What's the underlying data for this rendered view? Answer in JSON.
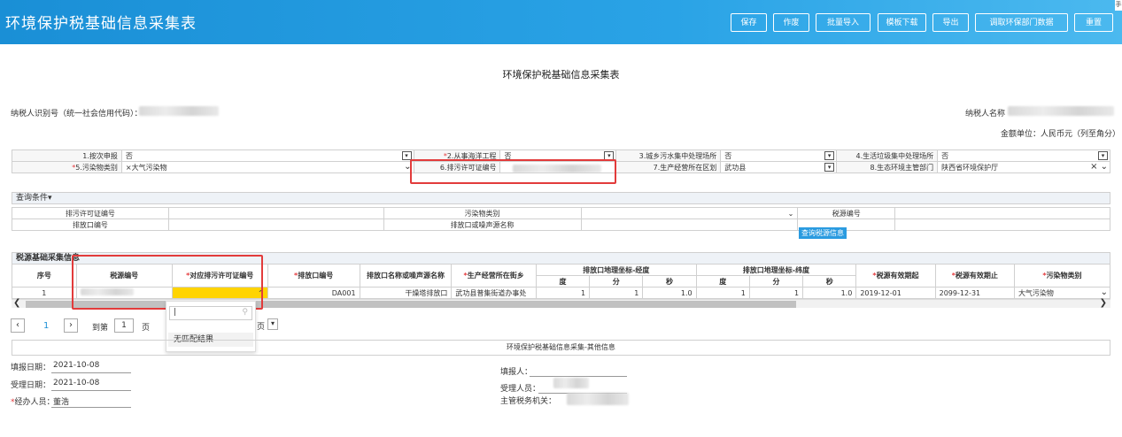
{
  "app": {
    "title": "环境保护税基础信息采集表",
    "corner": "手"
  },
  "toolbar": {
    "buttons": [
      "保存",
      "作废",
      "批量导入",
      "模板下载",
      "导出",
      "调取环保部门数据",
      "重置"
    ]
  },
  "page_title": "环境保护税基础信息采集表",
  "taxpayer": {
    "id_label": "纳税人识别号（统一社会信用代码）：",
    "name_label": "纳税人名称",
    "unit": "金额单位：人民币元（列至角分）"
  },
  "basic": {
    "r1": [
      {
        "label": "1.按次申报",
        "value": "否",
        "req": false
      },
      {
        "label": "2.从事海洋工程",
        "value": "否",
        "req": true
      },
      {
        "label": "3.城乡污水集中处理场所",
        "value": "否",
        "req": false
      },
      {
        "label": "4.生活垃圾集中处理场所",
        "value": "否",
        "req": false
      }
    ],
    "r2": [
      {
        "label": "5.污染物类别",
        "value": "×大气污染物",
        "req": true
      },
      {
        "label": "6.排污许可证编号",
        "value": "",
        "req": false
      },
      {
        "label": "7.生产经营所在区划",
        "value": "武功县",
        "req": false
      },
      {
        "label": "8.生态环境主管部门",
        "value": "陕西省环境保护厅",
        "req": false
      }
    ]
  },
  "query": {
    "title": "查询条件▾",
    "permit_label": "排污许可证编号",
    "pollutant_label": "污染物类别",
    "source_label": "税源编号",
    "outlet_label": "排放口编号",
    "outlet_name_label": "排放口或噪声源名称",
    "button": "查询税源信息"
  },
  "tax_source": {
    "title": "税源基础采集信息",
    "headers": {
      "seq": "序号",
      "src": "税源编号",
      "permit": "对应排污许可证编号",
      "outlet": "排放口编号",
      "name": "排放口名称或噪声源名称",
      "street": "生产经营所在街乡",
      "lng": "排放口地理坐标-经度",
      "lat": "排放口地理坐标-纬度",
      "deg": "度",
      "min": "分",
      "sec": "秒",
      "start": "税源有效期起",
      "end": "税源有效期止",
      "ptype": "污染物类别"
    },
    "row": {
      "seq": "1",
      "outlet": "DA001",
      "name": "干燥塔排放口",
      "street": "武功县普集街道办事处",
      "lng_d": "1",
      "lng_m": "1",
      "lng_s": "1.0",
      "lat_d": "1",
      "lat_m": "1",
      "lat_s": "1.0",
      "start": "2019-12-01",
      "end": "2099-12-31",
      "ptype": "大气污染物"
    }
  },
  "pager": {
    "page": "1",
    "goto": "到第",
    "input": "1",
    "unit": "页",
    "size_suffix": "页"
  },
  "dropdown": {
    "no_match": "无匹配结果"
  },
  "other": {
    "title": "环境保护税基础信息采集-其他信息",
    "fill_date_label": "填报日期：",
    "fill_date": "2021-10-08",
    "accept_date_label": "受理日期：",
    "accept_date": "2021-10-08",
    "agent_label": "经办人员：",
    "agent": "董浩",
    "filler_label": "填报人：",
    "acceptor_label": "受理人员：",
    "office_label": "主管税务机关："
  }
}
